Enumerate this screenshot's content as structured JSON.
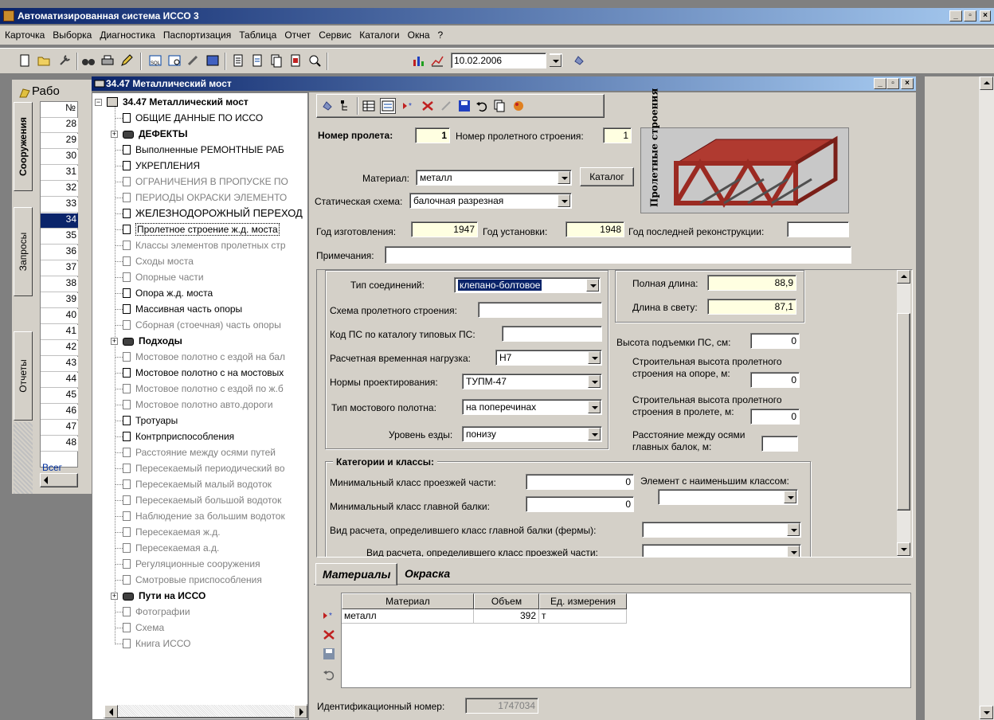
{
  "window": {
    "title": "Автоматизированная система ИССО 3"
  },
  "menu": [
    "Карточка",
    "Выборка",
    "Диагностика",
    "Паспортизация",
    "Таблица",
    "Отчет",
    "Сервис",
    "Каталоги",
    "Окна",
    "?"
  ],
  "toolbar": {
    "date_value": "10.02.2006"
  },
  "left_panel": {
    "header": "Рабо",
    "col_header": "№",
    "tabs": [
      "Сооружения",
      "Запросы",
      "Отчеты"
    ],
    "rows": [
      "28",
      "29",
      "30",
      "31",
      "32",
      "33",
      "34",
      "35",
      "36",
      "37",
      "38",
      "39",
      "40",
      "41",
      "42",
      "43",
      "44",
      "45",
      "46",
      "47",
      "48"
    ],
    "selected_row": "34",
    "footer": "Всег"
  },
  "child": {
    "title": "34.47 Металлический мост"
  },
  "tree": [
    {
      "label": "34.47 Металлический мост",
      "style": "root"
    },
    {
      "label": "ОБЩИЕ ДАННЫЕ ПО ИССО",
      "style": "normal"
    },
    {
      "label": "ДЕФЕКТЫ",
      "style": "folder"
    },
    {
      "label": "Выполненные РЕМОНТНЫЕ РАБ",
      "style": "normal"
    },
    {
      "label": "УКРЕПЛЕНИЯ",
      "style": "normal"
    },
    {
      "label": "ОГРАНИЧЕНИЯ В ПРОПУСКЕ ПО",
      "style": "grey"
    },
    {
      "label": "ПЕРИОДЫ ОКРАСКИ ЭЛЕМЕНТО",
      "style": "grey"
    },
    {
      "label": "ЖЕЛЕЗНОДОРОЖНЫЙ ПЕРЕХОД",
      "style": "normal"
    },
    {
      "label": "Пролетное строение ж.д. моста",
      "style": "selected"
    },
    {
      "label": "Классы элементов пролетных стр",
      "style": "grey"
    },
    {
      "label": "Сходы моста",
      "style": "grey"
    },
    {
      "label": "Опорные части",
      "style": "grey"
    },
    {
      "label": "Опора ж.д. моста",
      "style": "normal"
    },
    {
      "label": "Массивная часть опоры",
      "style": "normal"
    },
    {
      "label": "Сборная (стоечная) часть опоры",
      "style": "grey"
    },
    {
      "label": "Подходы",
      "style": "folder"
    },
    {
      "label": "Мостовое полотно с ездой на бал",
      "style": "grey"
    },
    {
      "label": "Мостовое полотно с на мостовых",
      "style": "normal"
    },
    {
      "label": "Мостовое полотно с ездой по ж.б",
      "style": "grey"
    },
    {
      "label": "Мостовое полотно авто.дороги",
      "style": "grey"
    },
    {
      "label": "Тротуары",
      "style": "normal"
    },
    {
      "label": "Контрприспособления",
      "style": "normal"
    },
    {
      "label": "Расстояние между осями путей",
      "style": "grey"
    },
    {
      "label": "Пересекаемый периодический во",
      "style": "grey"
    },
    {
      "label": "Пересекаемый малый водоток",
      "style": "grey"
    },
    {
      "label": "Пересекаемый большой водоток",
      "style": "grey"
    },
    {
      "label": "Наблюдение за большим водоток",
      "style": "grey"
    },
    {
      "label": "Пересекаемая ж.д.",
      "style": "grey"
    },
    {
      "label": "Пересекаемая а.д.",
      "style": "grey"
    },
    {
      "label": "Регуляционные сооружения",
      "style": "grey"
    },
    {
      "label": "Смотровые приспособления",
      "style": "grey"
    },
    {
      "label": "Пути на ИССО",
      "style": "folder"
    },
    {
      "label": "Фотографии",
      "style": "grey"
    },
    {
      "label": "Схема",
      "style": "grey"
    },
    {
      "label": "Книга ИССО",
      "style": "grey"
    }
  ],
  "form": {
    "span_label": "Номер пролета:",
    "span_value": "1",
    "superstructure_label": "Номер пролетного строения:",
    "superstructure_value": "1",
    "image_caption": "Пролетные строения",
    "material_label": "Материал:",
    "material_value": "металл",
    "catalog_button": "Каталог",
    "static_label": "Статическая схема:",
    "static_value": "балочная разрезная",
    "year_made_label": "Год изготовления:",
    "year_made_value": "1947",
    "year_install_label": "Год установки:",
    "year_install_value": "1948",
    "year_recon_label": "Год последней реконструкции:",
    "year_recon_value": "",
    "notes_label": "Примечания:",
    "notes_value": "",
    "joint_label": "Тип соединений:",
    "joint_value": "клепано-болтовое",
    "scheme_label": "Схема пролетного строения:",
    "scheme_value": "",
    "catalog_code_label": "Код ПС по каталогу типовых ПС:",
    "catalog_code_value": "",
    "load_label": "Расчетная временная нагрузка:",
    "load_value": "Н7",
    "norms_label": "Нормы проектирования:",
    "norms_value": "ТУПМ-47",
    "deck_label": "Тип мостового полотна:",
    "deck_value": "на поперечинах",
    "level_label": "Уровень езды:",
    "level_value": "понизу",
    "full_length_label": "Полная длина:",
    "full_length_value": "88,9",
    "clear_length_label": "Длина в свету:",
    "clear_length_value": "87,1",
    "lift_label": "Высота подъемки ПС, см:",
    "lift_value": "0",
    "height_support_label": "Строительная высота пролетного строения на опоре, м:",
    "height_support_value": "0",
    "height_span_label": "Строительная высота пролетного строения в пролете, м:",
    "height_span_value": "0",
    "beam_dist_label": "Расстояние между осями главных балок, м:",
    "beam_dist_value": "",
    "categories_title": "Категории и классы:",
    "min_road_class_label": "Минимальный класс проезжей части:",
    "min_road_class_value": "0",
    "min_girder_class_label": "Минимальный класс главной балки:",
    "min_girder_class_value": "0",
    "weakest_element_label": "Элемент с наименьшим классом:",
    "weakest_element_value": "",
    "girder_calc_label": "Вид расчета, определившего класс главной балки (фермы):",
    "girder_calc_value": "",
    "road_calc_label": "Вид расчета, определившего класс проезжей части:",
    "road_calc_value": ""
  },
  "materials": {
    "tabs": [
      "Материалы",
      "Окраска"
    ],
    "columns": [
      "Материал",
      "Объем",
      "Ед. измерения"
    ],
    "rows": [
      {
        "material": "металл",
        "volume": "392",
        "unit": "т"
      }
    ]
  },
  "footer": {
    "id_label": "Идентификационный номер:",
    "id_value": "1747034"
  },
  "colors": {
    "title_gradient_start": "#0a246a",
    "title_gradient_end": "#a6caf0",
    "face": "#d4d0c8",
    "highlight": "#0a246a",
    "yellow_field": "#ffffe1",
    "bridge_red": "#9b2a22"
  }
}
